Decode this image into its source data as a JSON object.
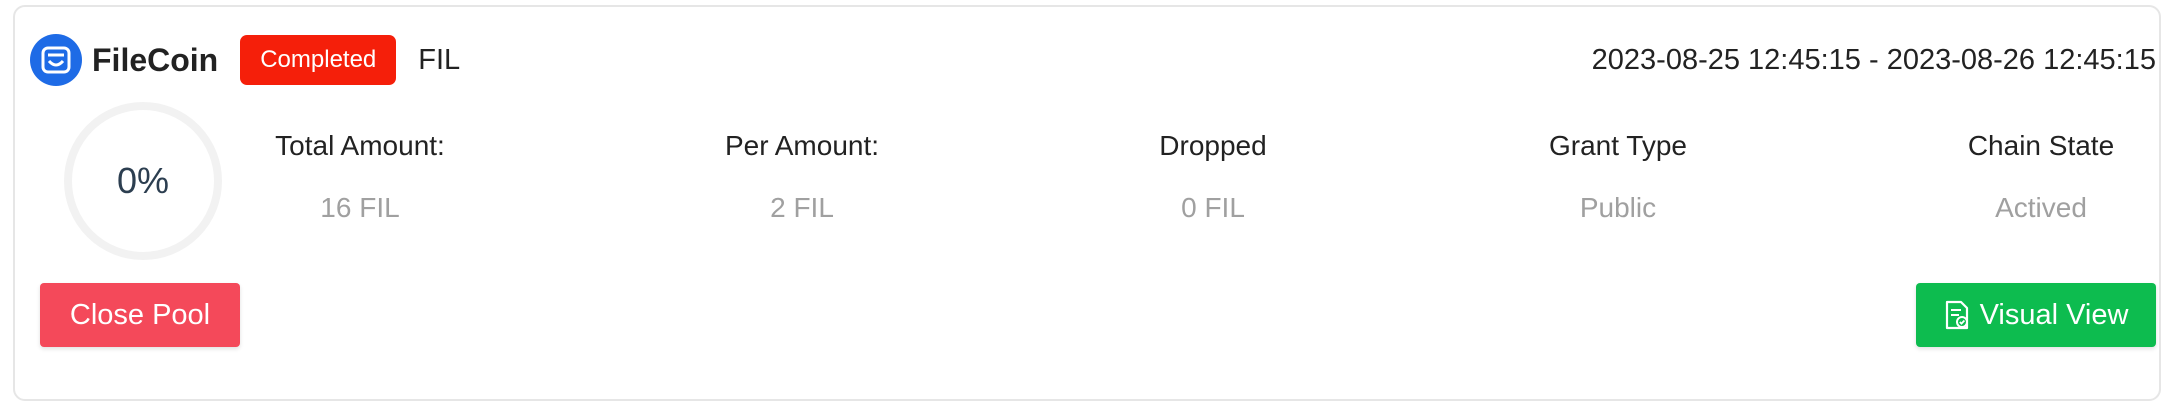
{
  "brand": {
    "name": "FileCoin",
    "logo_icon": "filecoin-logo-icon",
    "logo_color": "#1e6be6"
  },
  "status": {
    "label": "Completed",
    "color": "#f51f0a"
  },
  "token": "FIL",
  "date_range": "2023-08-25 12:45:15 - 2023-08-26 12:45:15",
  "progress": {
    "label": "0%",
    "value": 0
  },
  "stats": [
    {
      "label": "Total Amount:",
      "value": "16 FIL"
    },
    {
      "label": "Per Amount:",
      "value": "2 FIL"
    },
    {
      "label": "Dropped",
      "value": "0 FIL"
    },
    {
      "label": "Grant Type",
      "value": "Public"
    },
    {
      "label": "Chain State",
      "value": "Actived"
    }
  ],
  "actions": {
    "close_label": "Close Pool",
    "close_color": "#f4495a",
    "visual_label": "Visual View",
    "visual_icon": "document-check-icon",
    "visual_color": "#0dbc4f"
  }
}
